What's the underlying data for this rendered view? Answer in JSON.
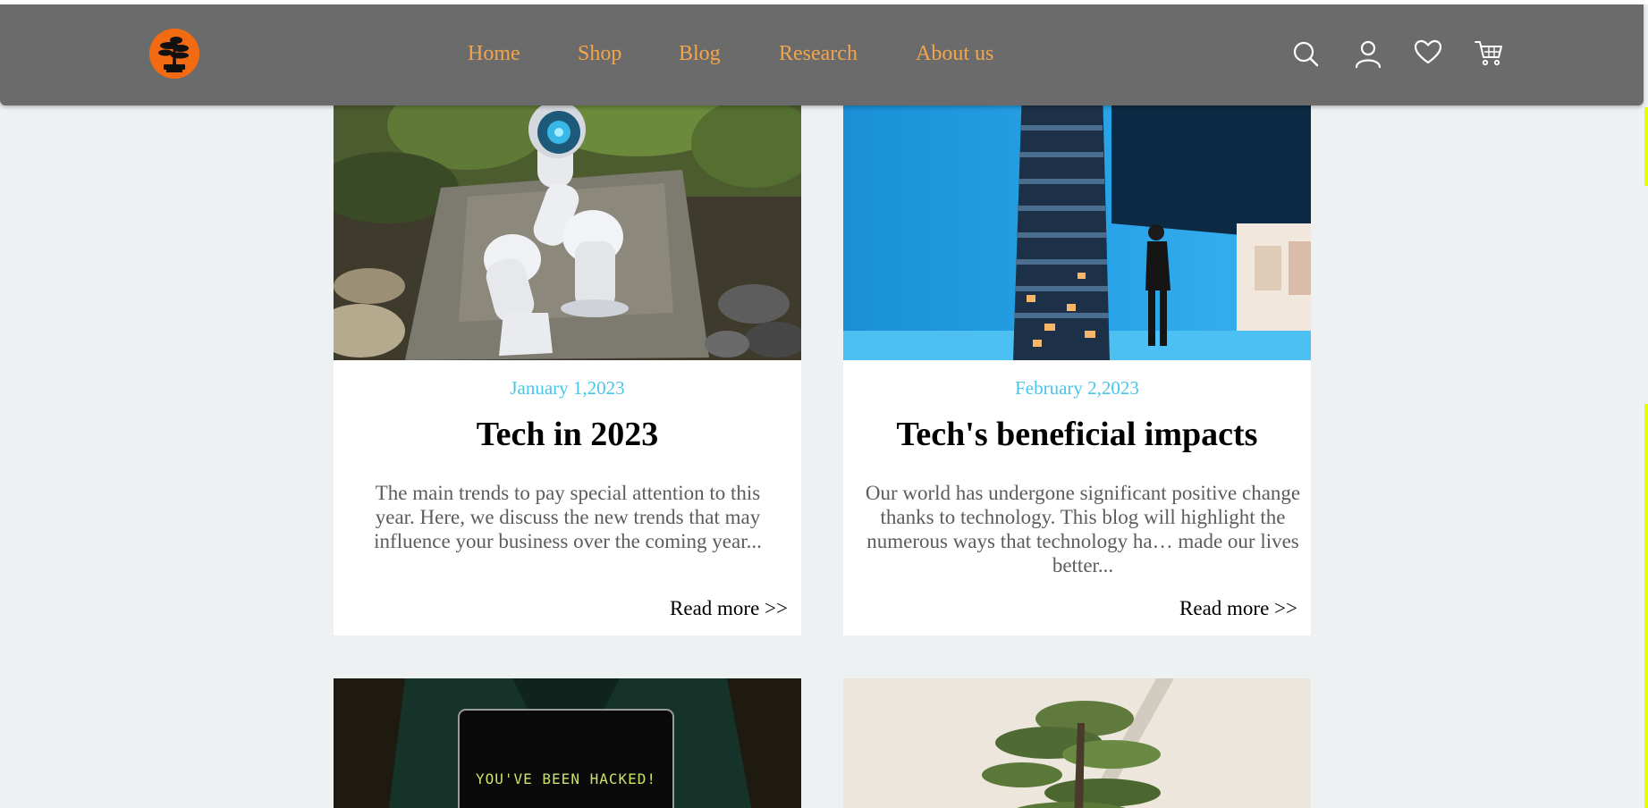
{
  "header": {
    "logo_icon": "bonsai-tree-logo",
    "logo_color": "#f26a12",
    "nav": [
      {
        "label": "Home"
      },
      {
        "label": "Shop"
      },
      {
        "label": "Blog"
      },
      {
        "label": "Research"
      },
      {
        "label": "About us"
      }
    ],
    "nav_color": "#f2a54a",
    "icons": [
      "search-icon",
      "user-icon",
      "heart-icon",
      "cart-icon"
    ]
  },
  "posts": [
    {
      "date": "January 1,2023",
      "title": "Tech in 2023",
      "excerpt": "The main trends to pay special attention to this year. Here, we discuss the new trends that may influence your business over the coming year...",
      "read_more": "Read more >>",
      "image": "robot-arm-photo"
    },
    {
      "date": "February 2,2023",
      "title": "Tech's beneficial impacts",
      "excerpt": "Our world has undergone significant positive change thanks to technology. This blog will highlight the numerous ways that technology ha… made our lives better...",
      "read_more": "Read more >>",
      "image": "tv-tower-installation-photo"
    },
    {
      "image": "hacked-laptop-photo",
      "image_text": "YOU'VE BEEN HACKED!"
    },
    {
      "image": "bonsai-tree-photo"
    }
  ],
  "colors": {
    "page_bg": "#edf1f1",
    "header_bg": "#6b6b6b",
    "date_color": "#45c6ea",
    "excerpt_color": "#5c5c5c"
  }
}
